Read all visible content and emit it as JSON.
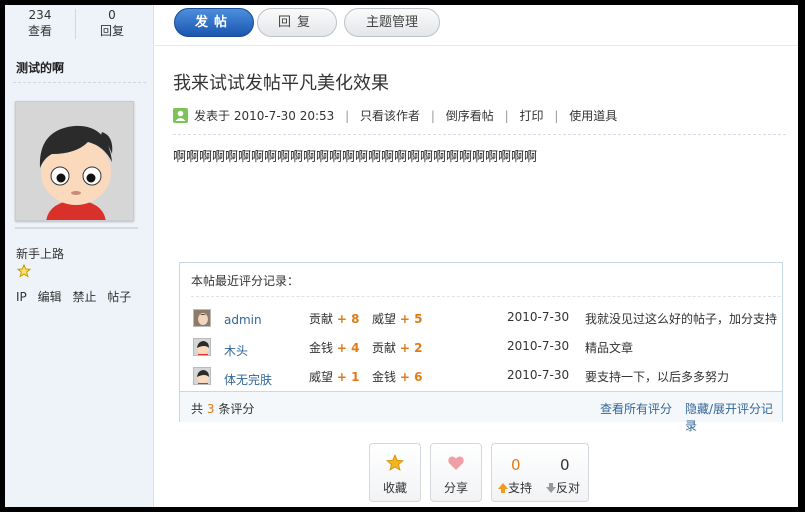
{
  "stats": {
    "views": "234",
    "views_label": "查看",
    "replies": "0",
    "replies_label": "回复"
  },
  "author": {
    "name": "测试的啊",
    "rank": "新手上路",
    "admin_links": [
      "IP",
      "编辑",
      "禁止",
      "帖子"
    ]
  },
  "toolbar": {
    "post_label": "发帖",
    "reply_label": "回复",
    "manage_label": "主题管理"
  },
  "post": {
    "title": "我来试试发帖平凡美化效果",
    "posted_at": "发表于 2010-7-30 20:53",
    "meta_links": [
      "只看该作者",
      "倒序看帖",
      "打印",
      "使用道具"
    ],
    "body": "啊啊啊啊啊啊啊啊啊啊啊啊啊啊啊啊啊啊啊啊啊啊啊啊啊啊啊啊"
  },
  "ratings": {
    "title": "本帖最近评分记录：",
    "rows": [
      {
        "user": "admin",
        "k1": "贡献",
        "v1": "+ 8",
        "k2": "威望",
        "v2": "+ 5",
        "date": "2010-7-30",
        "reason": "我就没见过这么好的帖子，加分支持"
      },
      {
        "user": "木头",
        "k1": "金钱",
        "v1": "+ 4",
        "k2": "贡献",
        "v2": "+ 2",
        "date": "2010-7-30",
        "reason": "精品文章"
      },
      {
        "user": "体无完肤",
        "k1": "威望",
        "v1": "+ 1",
        "k2": "金钱",
        "v2": "+ 6",
        "date": "2010-7-30",
        "reason": "要支持一下，以后多多努力"
      }
    ],
    "total_prefix": "共",
    "total_count": "3",
    "total_suffix": "条评分",
    "view_all": "查看所有评分",
    "toggle": "隐藏/展开评分记录"
  },
  "actions": {
    "favorite_label": "收藏",
    "share_label": "分享",
    "support_count": "0",
    "support_label": "支持",
    "oppose_count": "0",
    "oppose_label": "反对"
  },
  "colors": {
    "accent": "#1a56b0",
    "score": "#e07b1a",
    "link": "#336699"
  },
  "icons": [
    "star-icon",
    "user-icon",
    "heart-icon",
    "arrow-up-icon",
    "arrow-down-icon"
  ]
}
